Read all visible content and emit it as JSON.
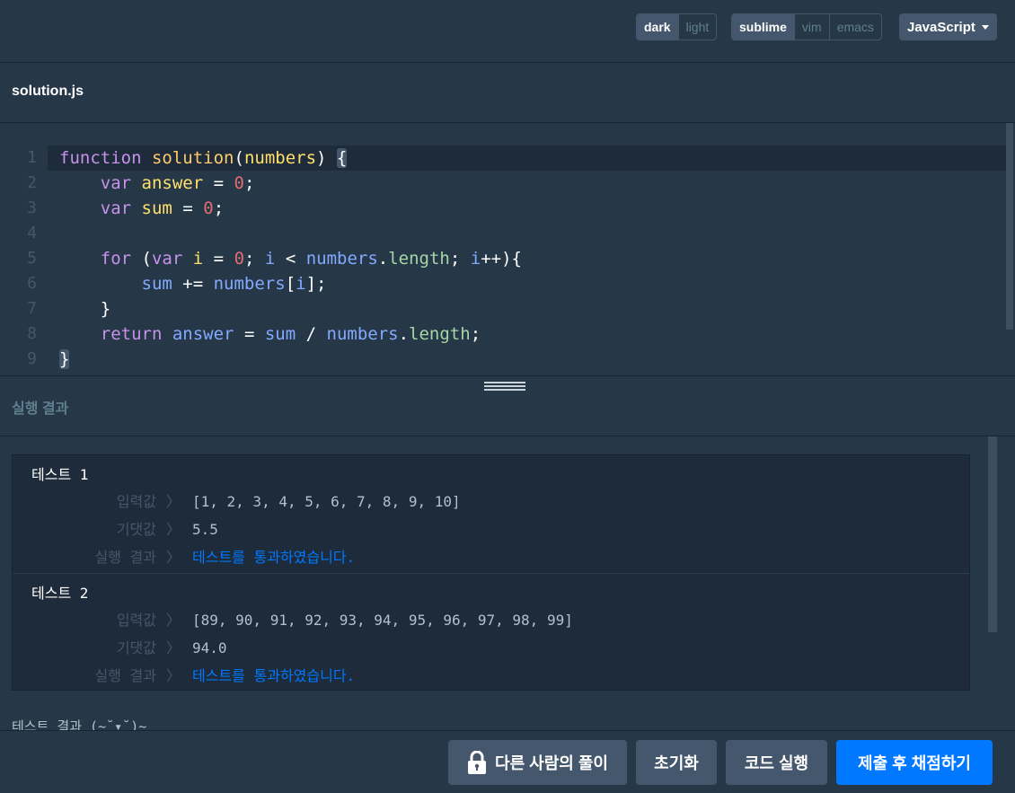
{
  "toolbar": {
    "theme_dark": "dark",
    "theme_light": "light",
    "keymap_sublime": "sublime",
    "keymap_vim": "vim",
    "keymap_emacs": "emacs",
    "language": "JavaScript"
  },
  "file": {
    "name": "solution.js"
  },
  "editor": {
    "line_numbers": [
      "1",
      "2",
      "3",
      "4",
      "5",
      "6",
      "7",
      "8",
      "9"
    ]
  },
  "results": {
    "header": "실행 결과",
    "labels": {
      "input": "입력값",
      "expected": "기댓값",
      "result": "실행 결과",
      "separator": "〉"
    },
    "cases": [
      {
        "title": "테스트 1",
        "input": "[1, 2, 3, 4, 5, 6, 7, 8, 9, 10]",
        "expected": "5.5",
        "result": "테스트를 통과하였습니다."
      },
      {
        "title": "테스트 2",
        "input": "[89, 90, 91, 92, 93, 94, 95, 96, 97, 98, 99]",
        "expected": "94.0",
        "result": "테스트를 통과하였습니다."
      }
    ],
    "summary_partial": "테스트 결과 (~˘▾˘)~"
  },
  "actions": {
    "others_solution": "다른 사람의 풀이",
    "reset": "초기화",
    "run": "코드 실행",
    "submit": "제출 후 채점하기"
  },
  "colors": {
    "background": "#263747",
    "panel": "#1e2b3a",
    "button_gray": "#44576c",
    "accent_blue": "#0078ff"
  },
  "icons": {
    "lock": "lock-icon",
    "caret": "caret-down-icon",
    "grip": "drag-handle-icon"
  }
}
